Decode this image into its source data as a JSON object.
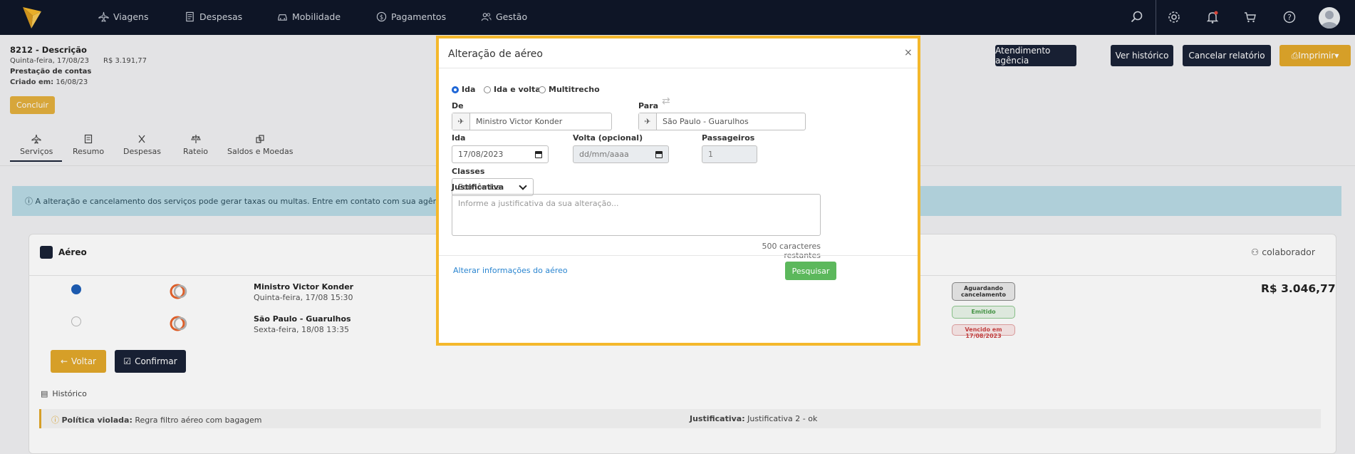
{
  "nav": {
    "items": [
      {
        "label": "Viagens",
        "icon": "plane-icon"
      },
      {
        "label": "Despesas",
        "icon": "receipt-icon"
      },
      {
        "label": "Mobilidade",
        "icon": "car-icon"
      },
      {
        "label": "Pagamentos",
        "icon": "dollar-icon"
      },
      {
        "label": "Gestão",
        "icon": "users-icon"
      }
    ]
  },
  "report": {
    "title": "8212 - Descrição",
    "date": "Quinta-feira, 17/08/23",
    "amount": "R$ 3.191,77",
    "type": "Prestação de contas",
    "created_label": "Criado em:",
    "created_value": "16/08/23",
    "concluir": "Concluir"
  },
  "actions": {
    "atendimento": "Atendimento agência",
    "historico": "Ver histórico",
    "cancelar": "Cancelar relatório",
    "imprimir": "Imprimir"
  },
  "tabs": [
    {
      "label": "Serviços"
    },
    {
      "label": "Resumo"
    },
    {
      "label": "Despesas"
    },
    {
      "label": "Rateio"
    },
    {
      "label": "Saldos e Moedas"
    }
  ],
  "alert": "A alteração e cancelamento dos serviços pode gerar taxas ou multas. Entre em contato com sua agência p",
  "card": {
    "title": "Aéreo",
    "collaborator": "colaborador",
    "flights": [
      {
        "city": "Ministro Victor Konder",
        "date": "Quinta-feira, 17/08 15:30"
      },
      {
        "city": "São Paulo - Guarulhos",
        "date": "Sexta-feira, 18/08 13:35"
      }
    ],
    "badges": {
      "aguardando": "Aguardando cancelamento",
      "emitido": "Emitido",
      "vencido": "Vencido em 17/08/2023"
    },
    "price": "R$ 3.046,77",
    "voltar": "Voltar",
    "confirmar": "Confirmar",
    "historico": "Histórico",
    "policy_label": "Política violada:",
    "policy_value": "Regra filtro aéreo com bagagem",
    "justificativa_label": "Justificativa:",
    "justificativa_value": "Justificativa 2 - ok"
  },
  "modal": {
    "title": "Alteração de aéreo",
    "close": "×",
    "trip_types": [
      "Ida",
      "Ida e volta",
      "Multitrecho"
    ],
    "selected_trip": "Ida",
    "from_label": "De",
    "from_value": "Ministro Victor Konder",
    "to_label": "Para",
    "to_value": "São Paulo - Guarulhos",
    "ida_label": "Ida",
    "ida_value": "17/08/2023",
    "volta_label": "Volta (opcional)",
    "volta_value": "dd/mm/aaaa",
    "passengers_label": "Passageiros",
    "passengers_value": "1",
    "classes_label": "Classes",
    "classes_value": "Econômica",
    "justificativa_label": "Justificativa",
    "justificativa_placeholder": "Informe a justificativa da sua alteração...",
    "chars_left": "500 caracteres restantes",
    "alter_link": "Alterar informações do aéreo",
    "search": "Pesquisar"
  }
}
